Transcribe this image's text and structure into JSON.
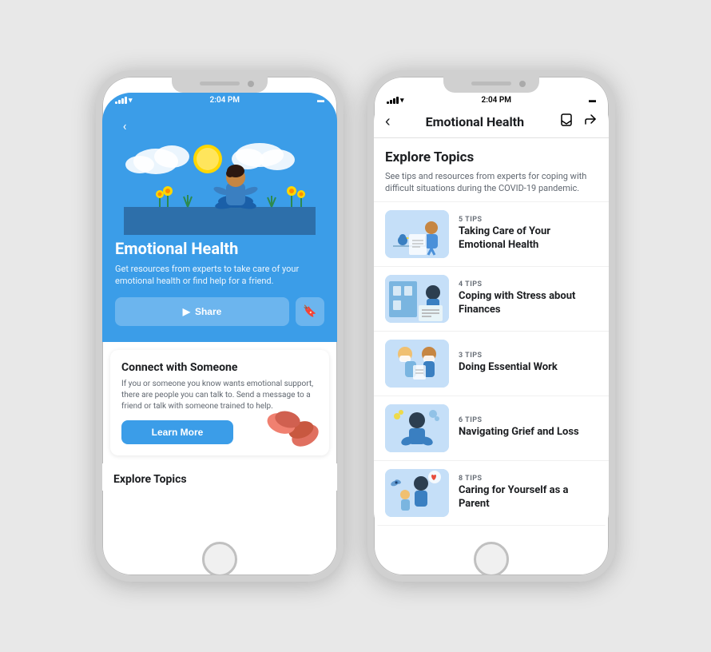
{
  "phone1": {
    "statusBar": {
      "time": "2:04 PM",
      "signal": "full",
      "wifi": true,
      "battery": "full"
    },
    "hero": {
      "backLabel": "‹",
      "title": "Emotional Health",
      "description": "Get resources from experts to take care of your emotional health or find help for a friend.",
      "shareLabel": "Share",
      "shareIcon": "▶",
      "bookmarkIcon": "🔖"
    },
    "connectCard": {
      "title": "Connect with Someone",
      "description": "If you or someone you know wants emotional support, there are people you can talk to. Send a message to a friend or talk with someone trained to help.",
      "learnMoreLabel": "Learn More"
    },
    "exploreSection": {
      "title": "Explore Topics"
    }
  },
  "phone2": {
    "statusBar": {
      "time": "2:04 PM"
    },
    "header": {
      "backIcon": "‹",
      "title": "Emotional Health",
      "bookmarkIcon": "🔖",
      "shareIcon": "↗"
    },
    "exploreTopics": {
      "title": "Explore Topics",
      "subtitle": "See tips and resources from experts for coping with difficult situations during the COVID-19 pandemic."
    },
    "topics": [
      {
        "tipsCount": "5 TIPS",
        "name": "Taking Care of Your Emotional Health",
        "color": "#c5dff8"
      },
      {
        "tipsCount": "4 TIPS",
        "name": "Coping with Stress about Finances",
        "color": "#c5dff8"
      },
      {
        "tipsCount": "3 TIPS",
        "name": "Doing Essential Work",
        "color": "#c5dff8"
      },
      {
        "tipsCount": "6 TIPS",
        "name": "Navigating Grief and Loss",
        "color": "#c5dff8"
      },
      {
        "tipsCount": "8 TIPS",
        "name": "Caring for Yourself as a Parent",
        "color": "#c5dff8"
      }
    ]
  }
}
